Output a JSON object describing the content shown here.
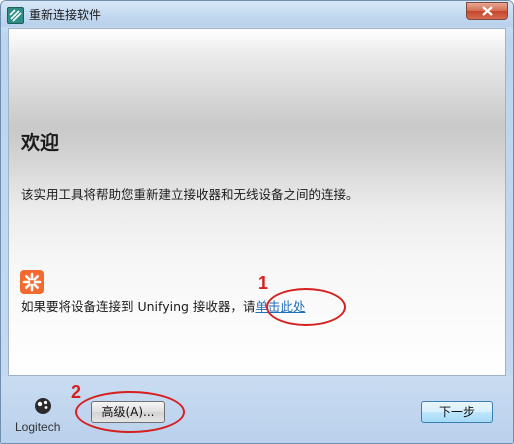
{
  "window": {
    "title": "重新连接软件",
    "close_label": "close"
  },
  "main": {
    "heading": "欢迎",
    "description": "该实用工具将帮助您重新建立接收器和无线设备之间的连接。",
    "unifying_prefix": "如果要将设备连接到 Unifying 接收器，请",
    "unifying_link": "单击此处"
  },
  "annotations": {
    "marker_1": "1",
    "marker_2": "2",
    "color": "#d61f1f"
  },
  "footer": {
    "logo_text": "Logitech",
    "advanced_button": "高级(A)...",
    "next_button": "下一步"
  },
  "colors": {
    "link": "#1f6fb8",
    "unifying_icon": "#f26a2d",
    "title_icon": "#2f8d87"
  }
}
